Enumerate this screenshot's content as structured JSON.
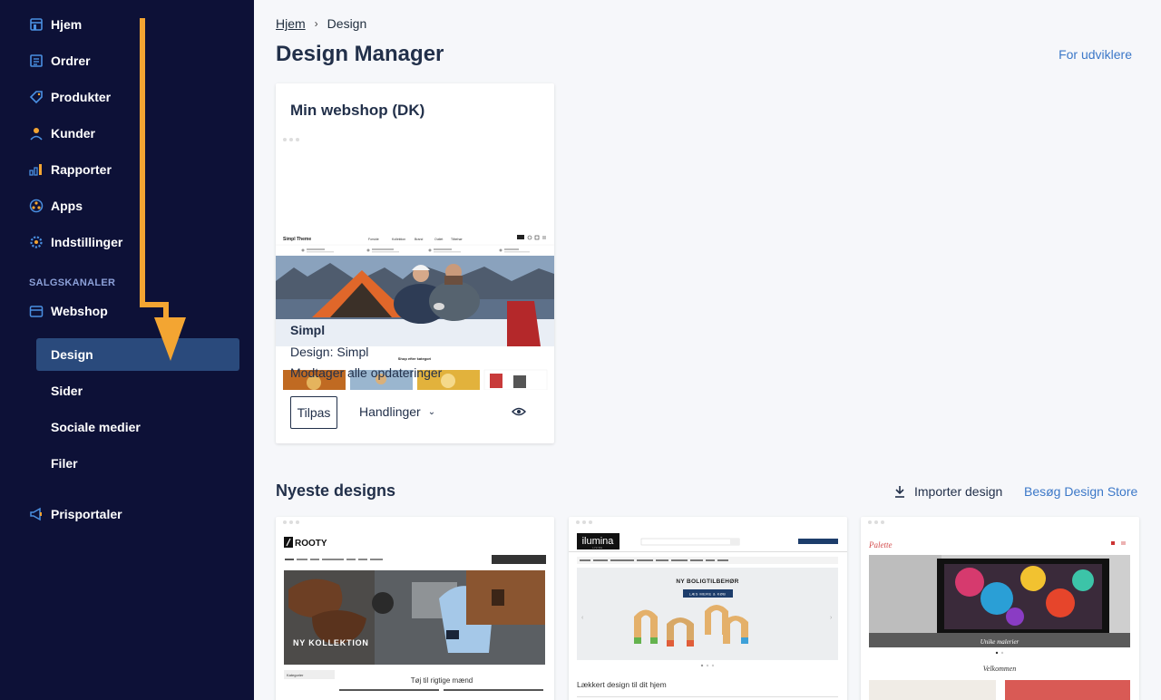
{
  "sidebar": {
    "nav": [
      {
        "label": "Hjem",
        "icon": "store-icon"
      },
      {
        "label": "Ordrer",
        "icon": "orders-icon"
      },
      {
        "label": "Produkter",
        "icon": "tag-icon"
      },
      {
        "label": "Kunder",
        "icon": "user-icon"
      },
      {
        "label": "Rapporter",
        "icon": "bar-chart-icon"
      },
      {
        "label": "Apps",
        "icon": "apps-icon"
      },
      {
        "label": "Indstillinger",
        "icon": "gear-icon"
      }
    ],
    "section_label": "SALGSKANALER",
    "webshop_label": "Webshop",
    "sub_items": [
      {
        "label": "Design",
        "active": true
      },
      {
        "label": "Sider"
      },
      {
        "label": "Sociale medier"
      },
      {
        "label": "Filer"
      }
    ],
    "pris_label": "Prisportaler"
  },
  "breadcrumb": {
    "home": "Hjem",
    "current": "Design"
  },
  "page_title": "Design Manager",
  "dev_link": "For udviklere",
  "shop_card": {
    "title": "Min webshop (DK)",
    "preview_brand": "Simpl Theme",
    "preview_nav": [
      "Forside",
      "Kollektion",
      "Brand",
      "Outlet",
      "Tilbehør"
    ],
    "preview_category": "Shop efter kategori",
    "theme_name": "Simpl",
    "design_line": "Design: Simpl",
    "update_line": "Modtager alle opdateringer",
    "customize_label": "Tilpas",
    "actions_label": "Handlinger"
  },
  "newest": {
    "title": "Nyeste designs",
    "import_label": "Importer design",
    "store_label": "Besøg Design Store",
    "designs": [
      {
        "brand": "ROOTY",
        "banner": "NY KOLLEKTION",
        "subtitle": "Tøj til rigtige mænd",
        "sidebar_label": "Kategorier"
      },
      {
        "brand": "ilumina",
        "brand_sub": "LIVING",
        "banner": "NY BOLIGTILBEHØR",
        "cta": "LÆS MERE & KØB",
        "subtitle": "Lækkert design til dit hjem"
      },
      {
        "brand": "Palette",
        "banner": "Unike malerier",
        "subtitle": "Velkommen"
      }
    ]
  },
  "colors": {
    "sidebar_bg": "#0d1137",
    "active_bg": "#2a4a7c",
    "accent": "#f3a532",
    "link": "#3c78c8"
  }
}
